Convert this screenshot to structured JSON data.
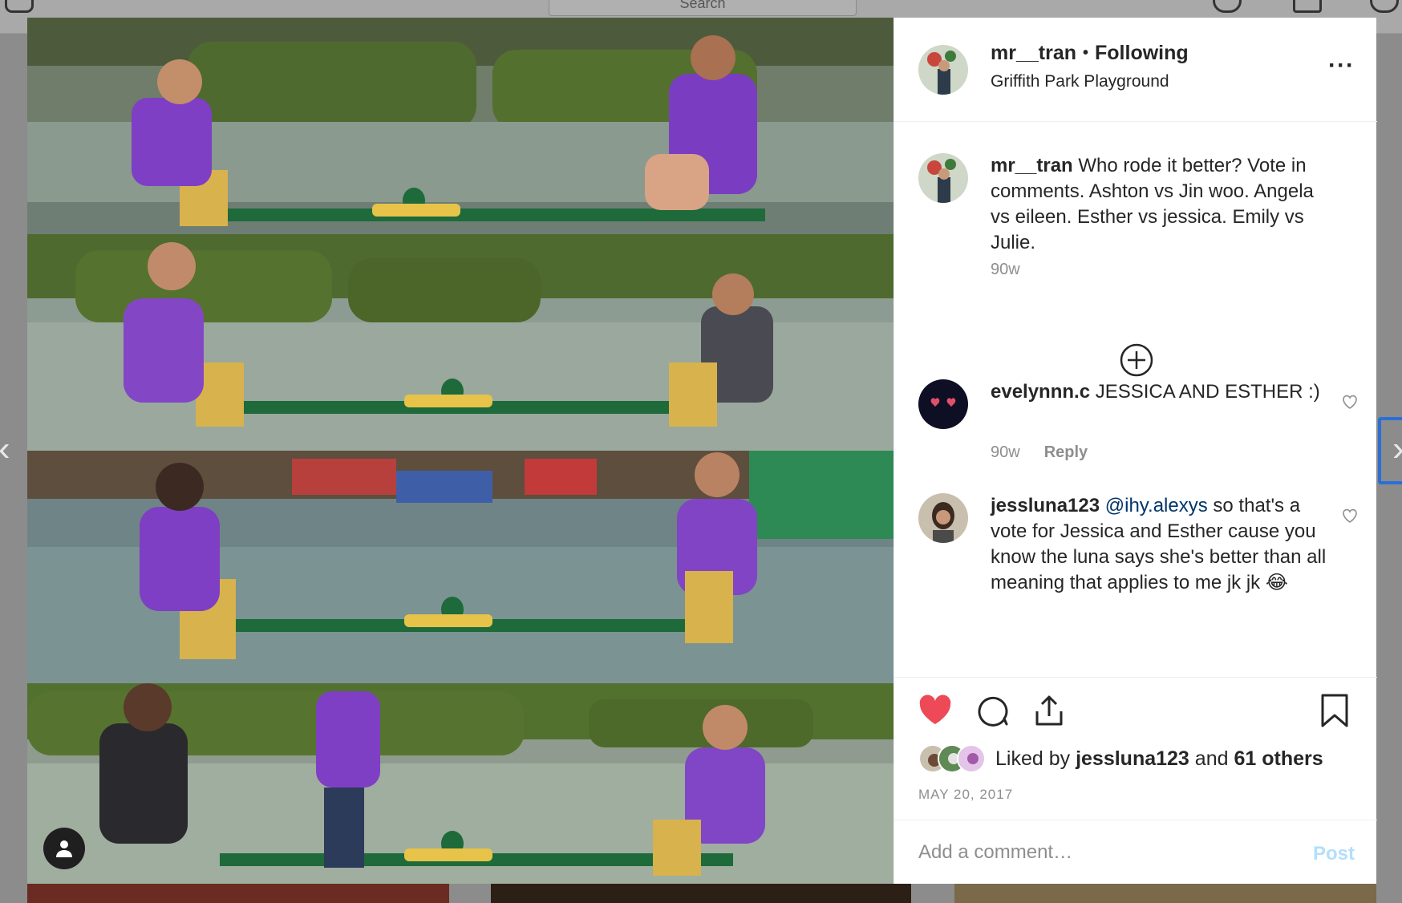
{
  "background": {
    "search_placeholder": "Search",
    "nav_prev_icon": "chevron-left-icon",
    "nav_next_icon": "chevron-right-icon"
  },
  "post": {
    "username": "mr__tran",
    "follow_status": "Following",
    "location": "Griffith Park Playground",
    "more_icon": "more-horizontal-icon",
    "caption": {
      "username": "mr__tran",
      "text": "Who rode it better? Vote in comments. Ashton vs Jin woo. Angela vs eileen. Esther vs jessica. Emily vs Julie.",
      "time": "90w"
    },
    "load_more_icon": "plus-circle-icon",
    "comments": [
      {
        "username": "evelynnn.c",
        "text": "JESSICA AND ESTHER :)",
        "time": "90w",
        "reply_label": "Reply"
      },
      {
        "username": "jessluna123",
        "mention": "@ihy.alexys",
        "text": "so that's a vote for Jessica and Esther cause you know the luna says she's better than all meaning that applies to me jk jk 😂"
      }
    ],
    "likes": {
      "prefix": "Liked by",
      "user": "jessluna123",
      "joiner": "and",
      "others": "61 others"
    },
    "date": "MAY 20, 2017",
    "add_comment_placeholder": "Add a comment…",
    "post_button_label": "Post"
  },
  "colors": {
    "like_red": "#ed4956",
    "post_button_disabled": "#b2dffc",
    "mention_blue": "#003569",
    "secondary_text": "#8e8e8e"
  }
}
